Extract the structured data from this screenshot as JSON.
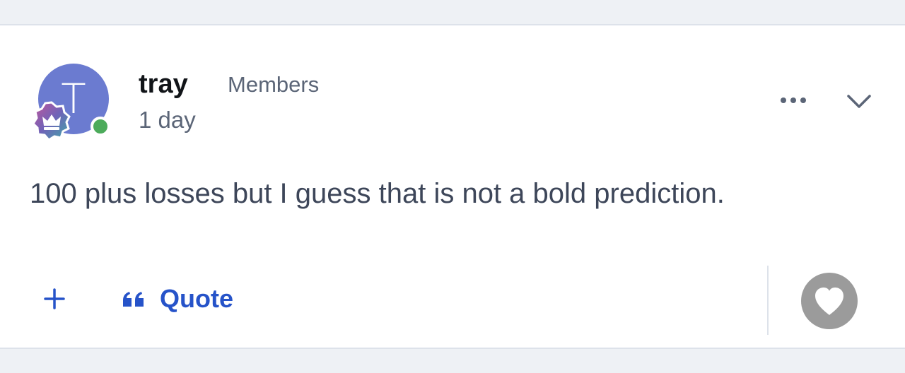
{
  "post": {
    "author": {
      "initial": "T",
      "username": "tray",
      "group": "Members",
      "online": true
    },
    "timestamp": "1 day",
    "content": "100 plus losses but I guess that is not a bold prediction.",
    "actions": {
      "add_icon": "plus-icon",
      "quote_icon": "quote-icon",
      "quote_label": "Quote",
      "like_icon": "heart-icon",
      "more_icon": "ellipsis-icon",
      "expand_icon": "chevron-down-icon"
    }
  },
  "colors": {
    "avatar": "#6b7bd0",
    "online": "#4cab5b",
    "accent": "#2653c9",
    "text": "#3d4659",
    "muted": "#5b6577",
    "like_bg": "#9b9b9b"
  }
}
